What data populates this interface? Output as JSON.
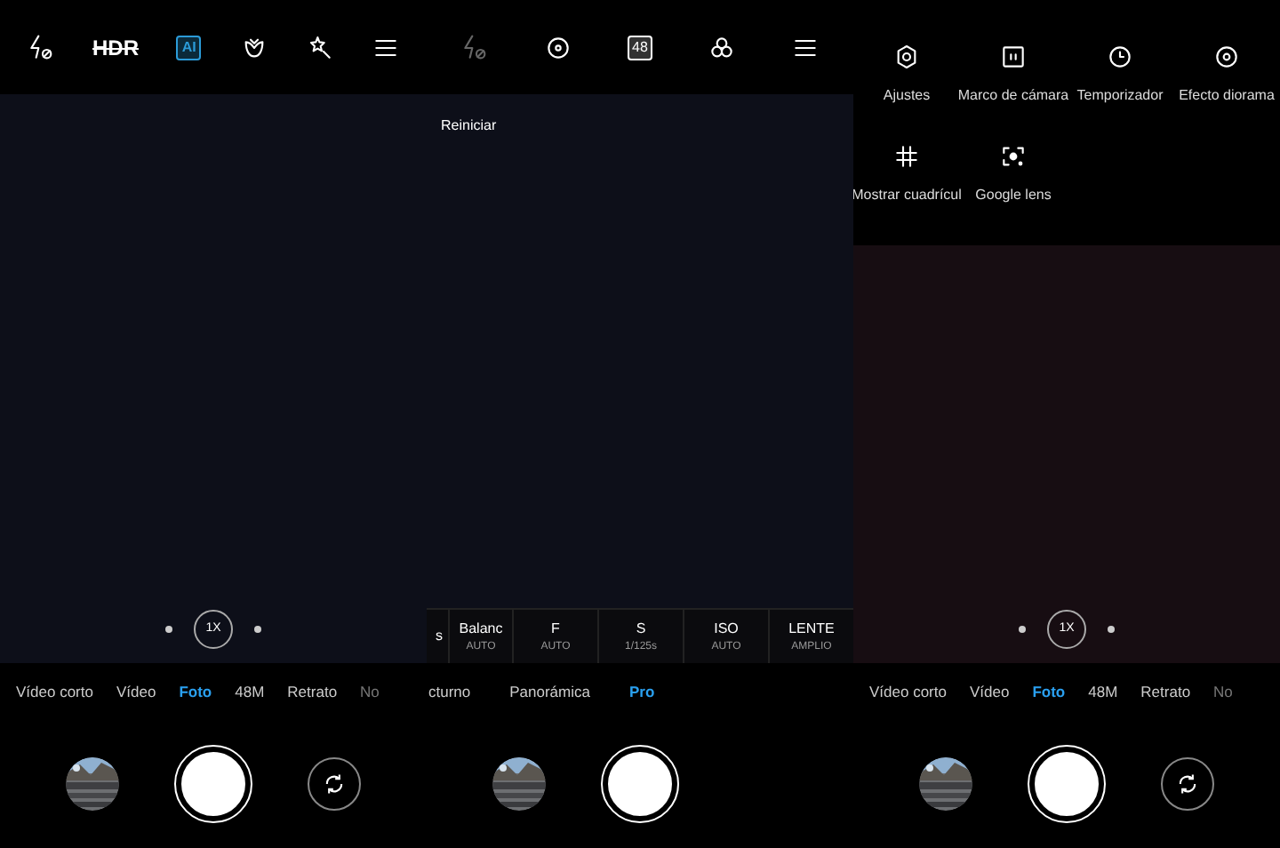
{
  "panels": [
    {
      "top_bar": [
        {
          "kind": "flash",
          "disabled": false
        },
        {
          "kind": "hdr",
          "label": "HDR",
          "on": false
        },
        {
          "kind": "ai",
          "label": "AI",
          "on": true
        },
        {
          "kind": "beauty"
        },
        {
          "kind": "magic"
        },
        {
          "kind": "menu"
        }
      ],
      "preview": {
        "zoom": "1X"
      },
      "modes": [
        {
          "label": "Vídeo corto",
          "selected": false
        },
        {
          "label": "Vídeo",
          "selected": false
        },
        {
          "label": "Foto",
          "selected": true
        },
        {
          "label": "48M",
          "selected": false
        },
        {
          "label": "Retrato",
          "selected": false
        },
        {
          "label": "No",
          "selected": false
        }
      ],
      "controls": {
        "flip": true
      }
    },
    {
      "top_bar": [
        {
          "kind": "flash",
          "disabled": true
        },
        {
          "kind": "focus"
        },
        {
          "kind": "mp",
          "label": "48"
        },
        {
          "kind": "filters"
        },
        {
          "kind": "menu"
        }
      ],
      "preview": {
        "reset": "Reiniciar"
      },
      "pro_settings": [
        {
          "label": "s"
        },
        {
          "label": "Balanc",
          "value": "AUTO"
        },
        {
          "label": "F",
          "value": "AUTO"
        },
        {
          "label": "S",
          "value": "1/125s"
        },
        {
          "label": "ISO",
          "value": "AUTO"
        },
        {
          "label": "LENTE",
          "value": "AMPLIO"
        }
      ],
      "modes": [
        {
          "label": "cturno",
          "selected": false
        },
        {
          "label": "Panorámica",
          "selected": false
        },
        {
          "label": "Pro",
          "selected": true
        }
      ]
    },
    {
      "menu": [
        {
          "kind": "gear",
          "label": "Ajustes"
        },
        {
          "kind": "frame",
          "label": "Marco de cámara"
        },
        {
          "kind": "clock",
          "label": "Temporizador"
        },
        {
          "kind": "ring",
          "label": "Efecto diorama"
        },
        {
          "kind": "grid",
          "label": "Mostrar cuadrícul"
        },
        {
          "kind": "lens",
          "label": "Google lens"
        }
      ],
      "preview": {
        "zoom": "1X"
      },
      "modes": [
        {
          "label": "Vídeo corto",
          "selected": false
        },
        {
          "label": "Vídeo",
          "selected": false
        },
        {
          "label": "Foto",
          "selected": true
        },
        {
          "label": "48M",
          "selected": false
        },
        {
          "label": "Retrato",
          "selected": false
        },
        {
          "label": "No",
          "selected": false
        }
      ],
      "controls": {
        "flip": true
      }
    }
  ]
}
